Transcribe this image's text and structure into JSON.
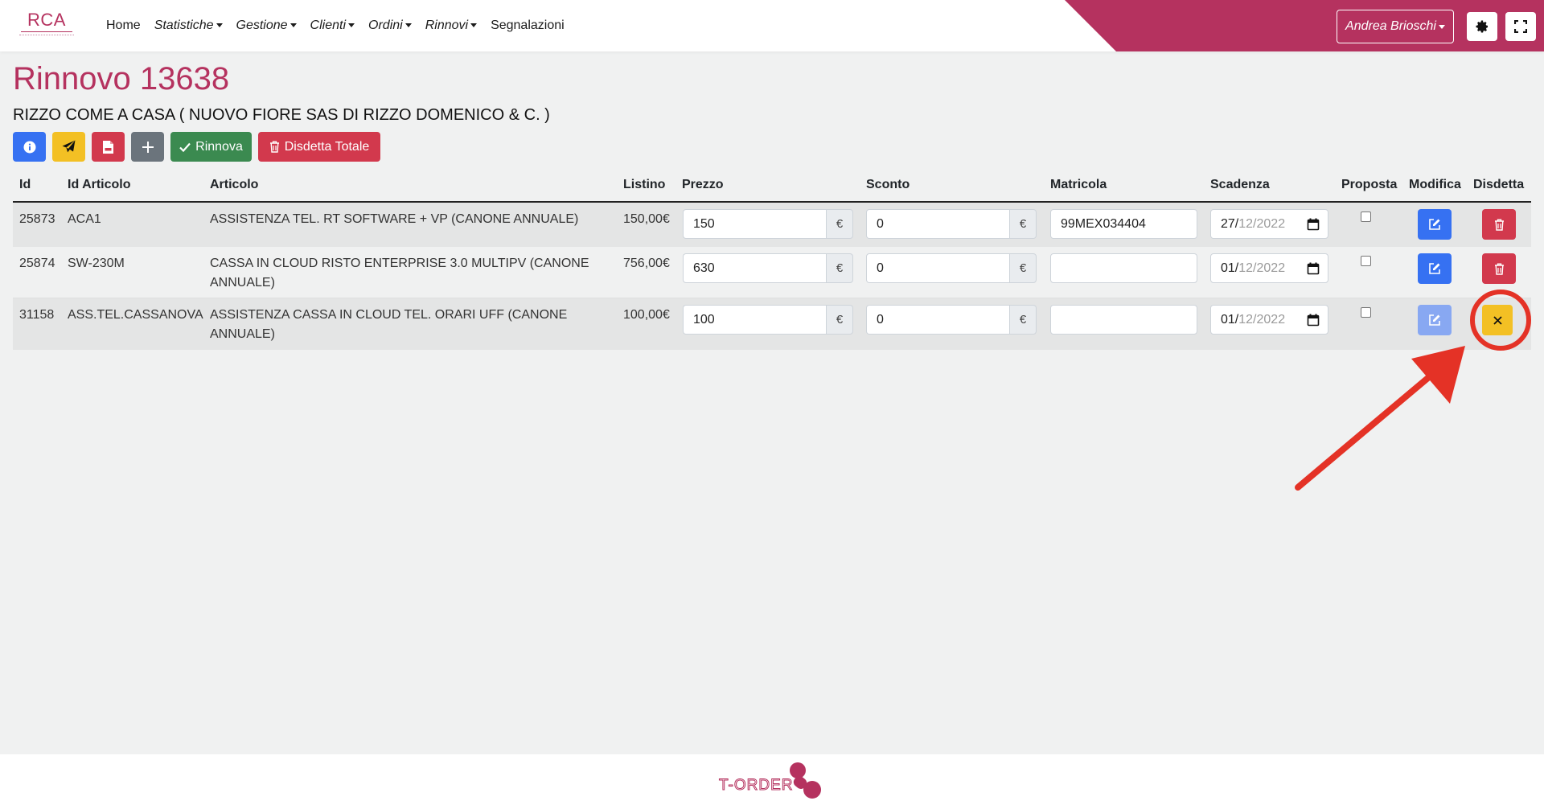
{
  "brand": {
    "logo_text": "RCA",
    "footer_logo_text": "T-ORDER",
    "accent_color": "#b5325f"
  },
  "nav": {
    "links": [
      {
        "label": "Home",
        "dropdown": false
      },
      {
        "label": "Statistiche",
        "dropdown": true
      },
      {
        "label": "Gestione",
        "dropdown": true
      },
      {
        "label": "Clienti",
        "dropdown": true
      },
      {
        "label": "Ordini",
        "dropdown": true
      },
      {
        "label": "Rinnovi",
        "dropdown": true
      },
      {
        "label": "Segnalazioni",
        "dropdown": false
      }
    ],
    "user_name": "Andrea Brioschi",
    "settings_icon": "gear-icon",
    "fullscreen_icon": "expand-icon"
  },
  "page": {
    "title": "Rinnovo 13638",
    "client": "RIZZO COME A CASA ( NUOVO FIORE SAS DI RIZZO DOMENICO & C. )"
  },
  "toolbar": {
    "info_icon": "info-icon",
    "send_icon": "paper-plane-icon",
    "pdf_icon": "pdf-file-icon",
    "add_icon": "plus-icon",
    "rinnova_label": "Rinnova",
    "disdetta_totale_label": "Disdetta Totale"
  },
  "table": {
    "headers": {
      "id": "Id",
      "id_articolo": "Id Articolo",
      "articolo": "Articolo",
      "listino": "Listino",
      "prezzo": "Prezzo",
      "sconto": "Sconto",
      "matricola": "Matricola",
      "scadenza": "Scadenza",
      "proposta": "Proposta",
      "modifica": "Modifica",
      "disdetta": "Disdetta"
    },
    "currency": "€",
    "rows": [
      {
        "id": "25873",
        "id_articolo": "ACA1",
        "articolo": "ASSISTENZA TEL. RT SOFTWARE + VP (CANONE ANNUALE)",
        "listino": "150,00€",
        "prezzo": "150",
        "sconto": "0",
        "matricola": "99MEX034404",
        "scadenza_day": "27/",
        "scadenza_rest": "12/2022",
        "proposta": false,
        "modifica_enabled": true,
        "disdetta_state": "delete"
      },
      {
        "id": "25874",
        "id_articolo": "SW-230M",
        "articolo": "CASSA IN CLOUD RISTO ENTERPRISE 3.0 MULTIPV (CANONE ANNUALE)",
        "listino": "756,00€",
        "prezzo": "630",
        "sconto": "0",
        "matricola": "",
        "scadenza_day": "01/",
        "scadenza_rest": "12/2022",
        "proposta": false,
        "modifica_enabled": true,
        "disdetta_state": "delete"
      },
      {
        "id": "31158",
        "id_articolo": "ASS.TEL.CASSANOVA",
        "articolo": "ASSISTENZA CASSA IN CLOUD TEL. ORARI UFF (CANONE ANNUALE)",
        "listino": "100,00€",
        "prezzo": "100",
        "sconto": "0",
        "matricola": "",
        "scadenza_day": "01/",
        "scadenza_rest": "12/2022",
        "proposta": false,
        "modifica_enabled": false,
        "disdetta_state": "cancelled"
      }
    ]
  },
  "annotation": {
    "color": "#e43226"
  }
}
